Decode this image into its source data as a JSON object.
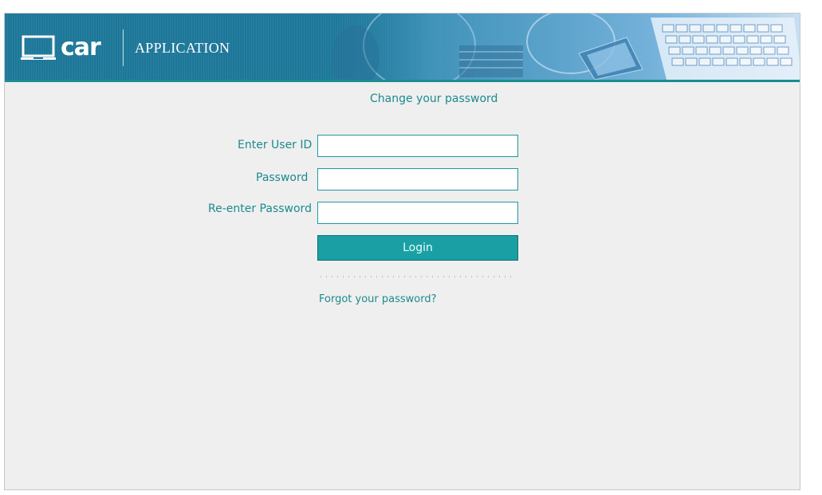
{
  "header": {
    "logo_text": "car",
    "app_name": "APPLICATION"
  },
  "form": {
    "title": "Change your password",
    "user_id_label": "Enter User ID",
    "user_id_value": "",
    "password_label": "Password",
    "password_value": "",
    "reenter_label": "Re-enter Password",
    "reenter_value": "",
    "login_label": "Login",
    "forgot_link": "Forgot your password?"
  },
  "colors": {
    "banner": "#1d7799",
    "accent": "#1c8a8c",
    "button": "#1aa0a4",
    "background": "#efefef"
  },
  "icons": {
    "logo_icon": "laptop-icon"
  }
}
